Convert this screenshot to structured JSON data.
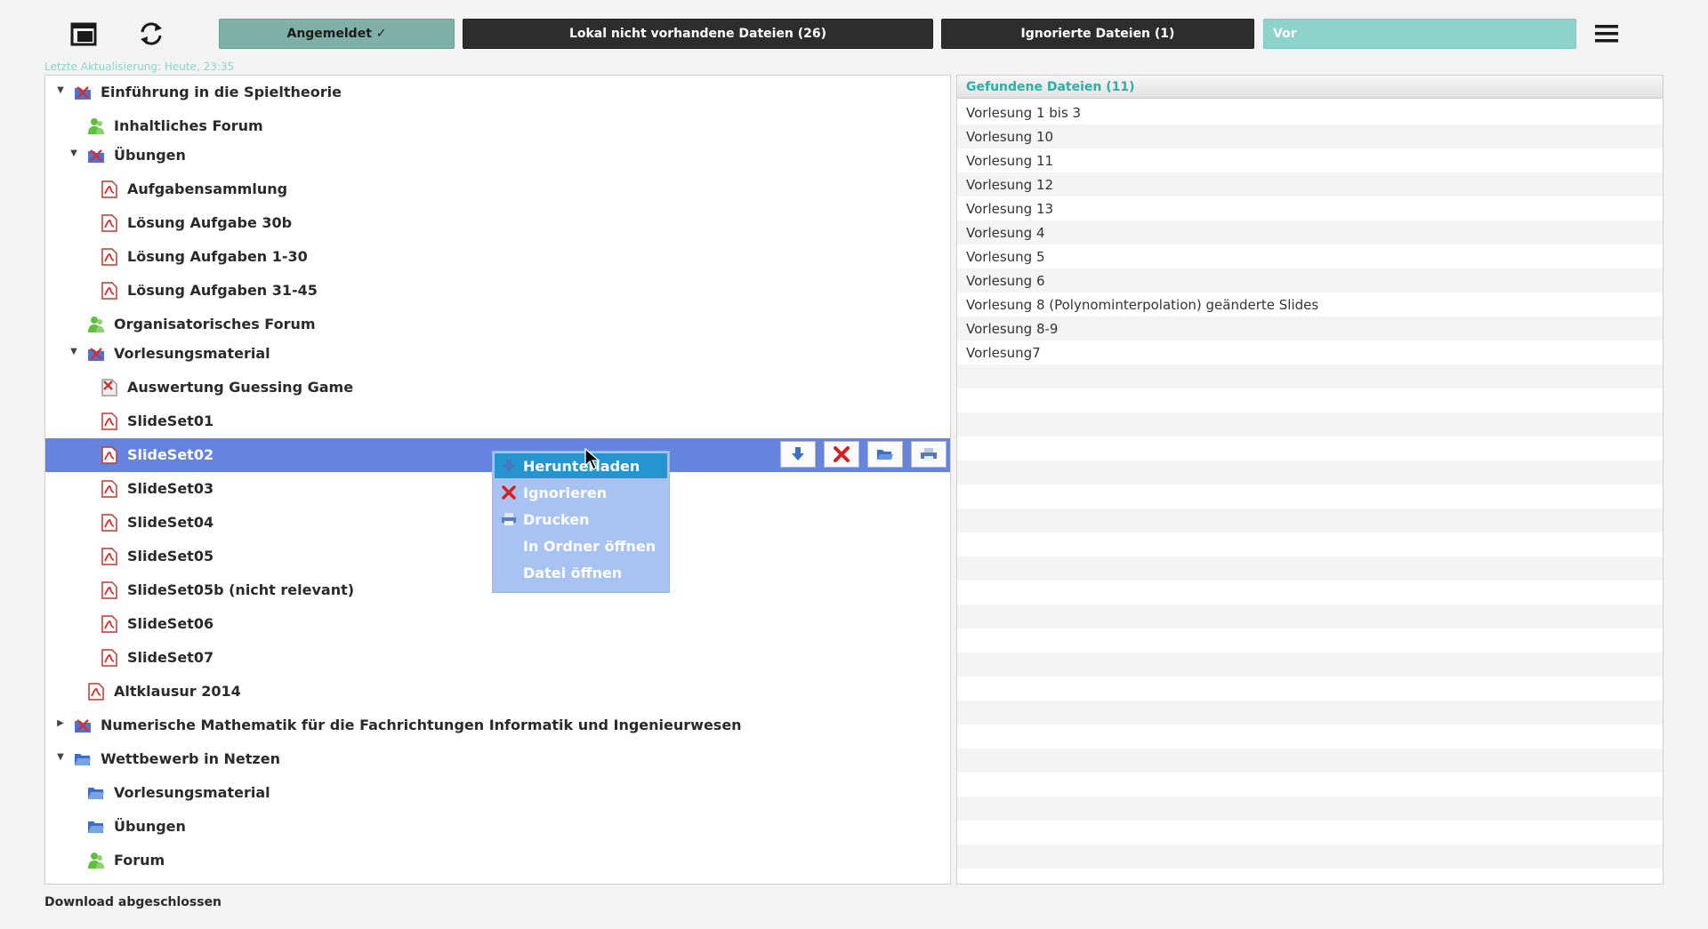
{
  "toolbar": {
    "logged_in_label": "Angemeldet ✓",
    "missing_files_label": "Lokal nicht vorhandene Dateien (26)",
    "ignored_files_label": "Ignorierte Dateien (1)",
    "next_label": "Vor",
    "icons": [
      "window-icon",
      "refresh-icon",
      "hamburger-menu-icon"
    ]
  },
  "last_update": "Letzte Aktualisierung: Heute, 23:35",
  "tree": {
    "items": [
      {
        "label": "Einführung in die Spieltheorie",
        "type": "course",
        "expanded": true
      },
      {
        "label": "Inhaltliches Forum",
        "type": "forum"
      },
      {
        "label": "Übungen",
        "type": "course",
        "expanded": true
      },
      {
        "label": "Aufgabensammlung",
        "type": "pdf"
      },
      {
        "label": "Lösung Aufgabe 30b",
        "type": "pdf"
      },
      {
        "label": "Lösung Aufgaben 1-30",
        "type": "pdf"
      },
      {
        "label": "Lösung Aufgaben 31-45",
        "type": "pdf"
      },
      {
        "label": "Organisatorisches Forum",
        "type": "forum"
      },
      {
        "label": "Vorlesungsmaterial",
        "type": "course",
        "expanded": true
      },
      {
        "label": "Auswertung Guessing Game",
        "type": "file-x"
      },
      {
        "label": "SlideSet01",
        "type": "pdf"
      },
      {
        "label": "SlideSet02",
        "type": "pdf",
        "selected": true
      },
      {
        "label": "SlideSet03",
        "type": "pdf"
      },
      {
        "label": "SlideSet04",
        "type": "pdf"
      },
      {
        "label": "SlideSet05",
        "type": "pdf"
      },
      {
        "label": "SlideSet05b (nicht relevant)",
        "type": "pdf"
      },
      {
        "label": "SlideSet06",
        "type": "pdf"
      },
      {
        "label": "SlideSet07",
        "type": "pdf"
      },
      {
        "label": "Altklausur 2014",
        "type": "pdf"
      },
      {
        "label": "Numerische Mathematik für die Fachrichtungen Informatik und Ingenieurwesen",
        "type": "course",
        "expanded": false
      },
      {
        "label": "Wettbewerb in Netzen",
        "type": "folder",
        "expanded": true
      },
      {
        "label": "Vorlesungsmaterial",
        "type": "folder"
      },
      {
        "label": "Übungen",
        "type": "folder"
      },
      {
        "label": "Forum",
        "type": "forum"
      }
    ]
  },
  "context_menu": {
    "items": [
      {
        "label": "Herunterladen",
        "icon": "download-icon",
        "active": true
      },
      {
        "label": "Ignorieren",
        "icon": "ignore-x-icon"
      },
      {
        "label": "Drucken",
        "icon": "print-icon"
      },
      {
        "label": "In Ordner öffnen",
        "icon": ""
      },
      {
        "label": "Datei öffnen",
        "icon": ""
      }
    ]
  },
  "found_files": {
    "header": "Gefundene Dateien (11)",
    "items": [
      "Vorlesung 1 bis 3",
      "Vorlesung 10",
      "Vorlesung 11",
      "Vorlesung 12",
      "Vorlesung 13",
      "Vorlesung 4",
      "Vorlesung 5",
      "Vorlesung 6",
      "Vorlesung 8 (Polynominterpolation) geänderte Slides",
      "Vorlesung 8-9",
      "Vorlesung7"
    ]
  },
  "status": "Download abgeschlossen",
  "colors": {
    "selected_row": "#6584e0",
    "context_menu_bg": "#a8c3f1",
    "context_menu_active": "#2594cf",
    "accent_teal": "#8dd3cb",
    "logged_in_green": "#7fb0a8"
  }
}
